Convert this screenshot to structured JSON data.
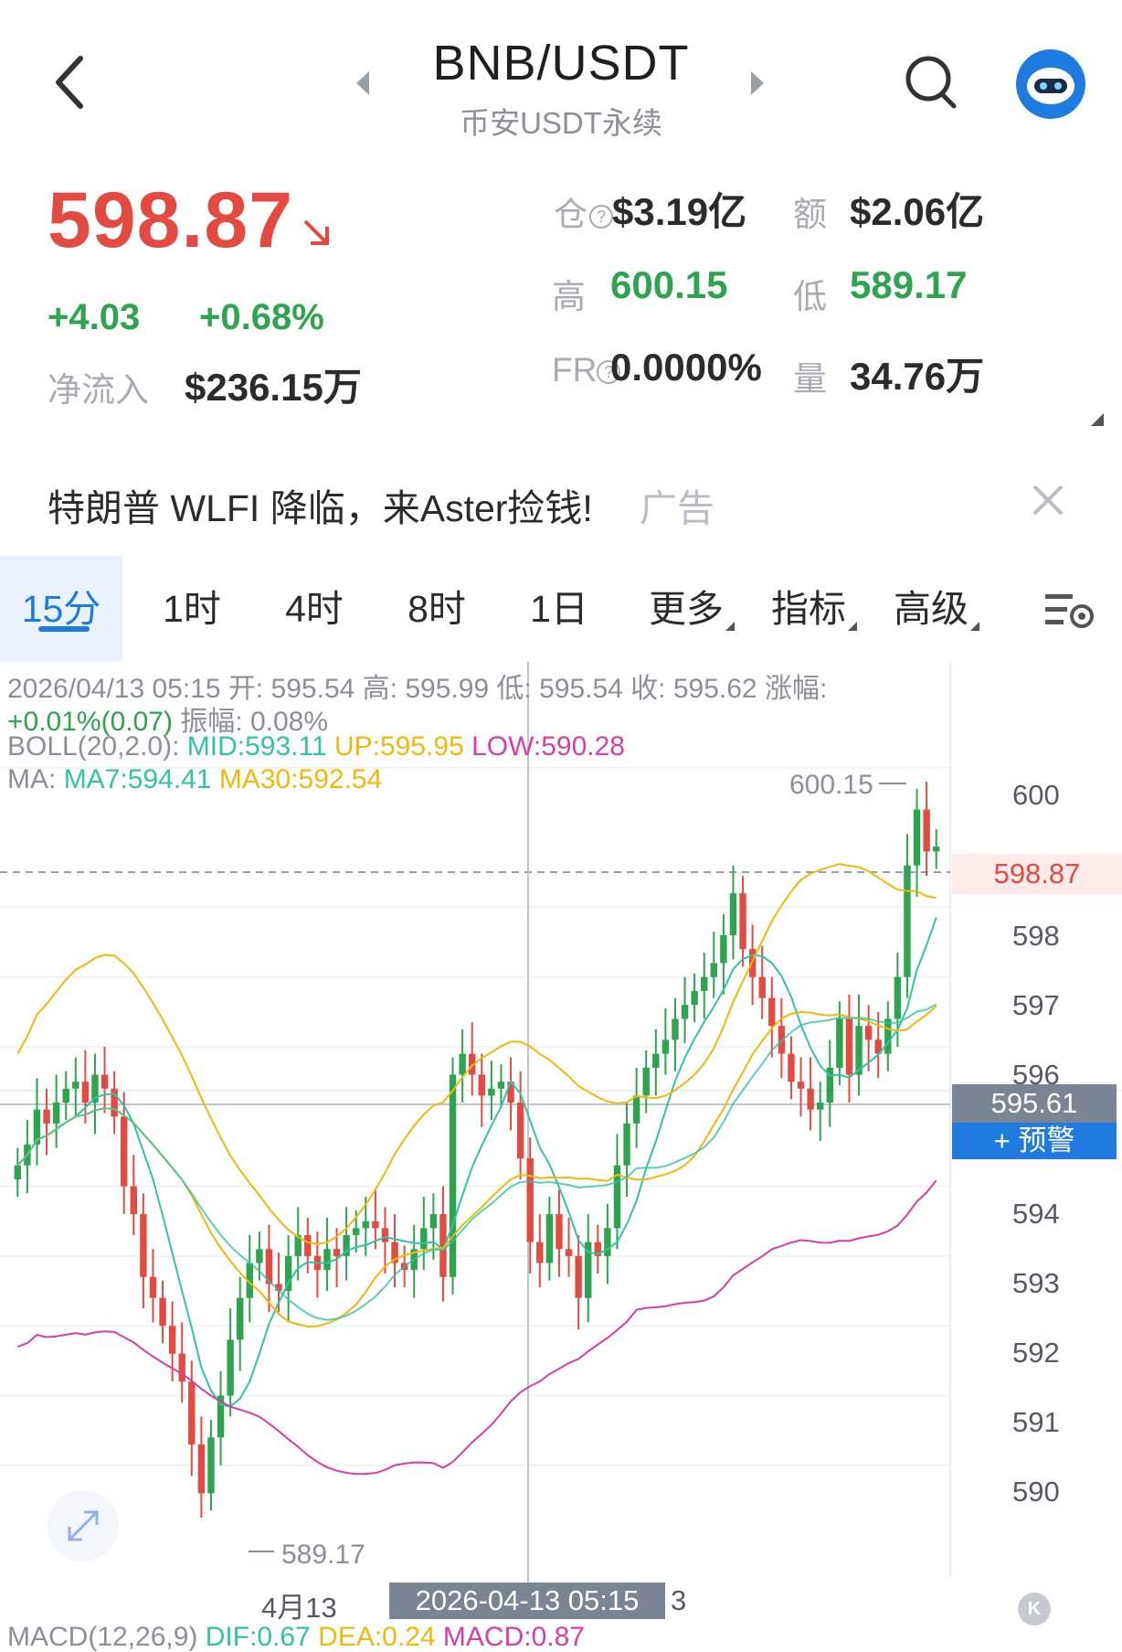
{
  "header": {
    "pair": "BNB/USDT",
    "subtitle": "币安USDT永续"
  },
  "ticker": {
    "last_price": "598.87",
    "change_abs": "+4.03",
    "change_pct": "+0.68%",
    "net_inflow_label": "净流入",
    "net_inflow_value": "$236.15万",
    "stats": {
      "oi_label": "仓",
      "oi_value": "$3.19亿",
      "turnover_label": "额",
      "turnover_value": "$2.06亿",
      "high_label": "高",
      "high_value": "600.15",
      "low_label": "低",
      "low_value": "589.17",
      "fr_label": "FR",
      "fr_value": "0.0000%",
      "volume_label": "量",
      "volume_value": "34.76万"
    }
  },
  "ad": {
    "text": "特朗普 WLFI 降临，来Aster捡钱!",
    "tag": "广告"
  },
  "tabs": [
    {
      "label": "15分",
      "active": true
    },
    {
      "label": "1时"
    },
    {
      "label": "4时"
    },
    {
      "label": "8时"
    },
    {
      "label": "1日"
    },
    {
      "label": "更多"
    },
    {
      "label": "指标"
    },
    {
      "label": "高级"
    }
  ],
  "info": {
    "line1": "2026/04/13 05:15 开:  595.54 高:  595.99 低:  595.54 收:  595.62 涨幅:",
    "line2_change": "+0.01%(0.07)",
    "line2_rest": " 振幅:  0.08%",
    "boll_label": "BOLL(20,2.0):",
    "boll_mid": "MID:593.11",
    "boll_up": "UP:595.95",
    "boll_low": "LOW:590.28",
    "ma_label": "MA:",
    "ma7": "MA7:594.41",
    "ma30": "MA30:592.54"
  },
  "chart": {
    "y_ticks": [
      "600",
      "598",
      "597",
      "596",
      "594",
      "593",
      "592",
      "591",
      "590"
    ],
    "current_price_tag": "598.87",
    "crosshair_price": "595.61",
    "alert_label": "+ 预警",
    "high_marker": "600.15",
    "low_marker": "589.17",
    "date_label": "4月13",
    "crosshair_date": "2026-04-13 05:15",
    "crosshair_date_tail": "3",
    "k_badge": "K"
  },
  "macd": {
    "label": "MACD(12,26,9)",
    "dif": "DIF:0.67",
    "dea": "DEA:0.24",
    "macd": "MACD:0.87"
  },
  "colors": {
    "up": "#2ea44f",
    "down": "#e34a42",
    "accent": "#1f7be0",
    "boll_mid": "#32c3a6",
    "boll_up": "#f0b90b",
    "boll_low": "#d63fa4"
  }
}
